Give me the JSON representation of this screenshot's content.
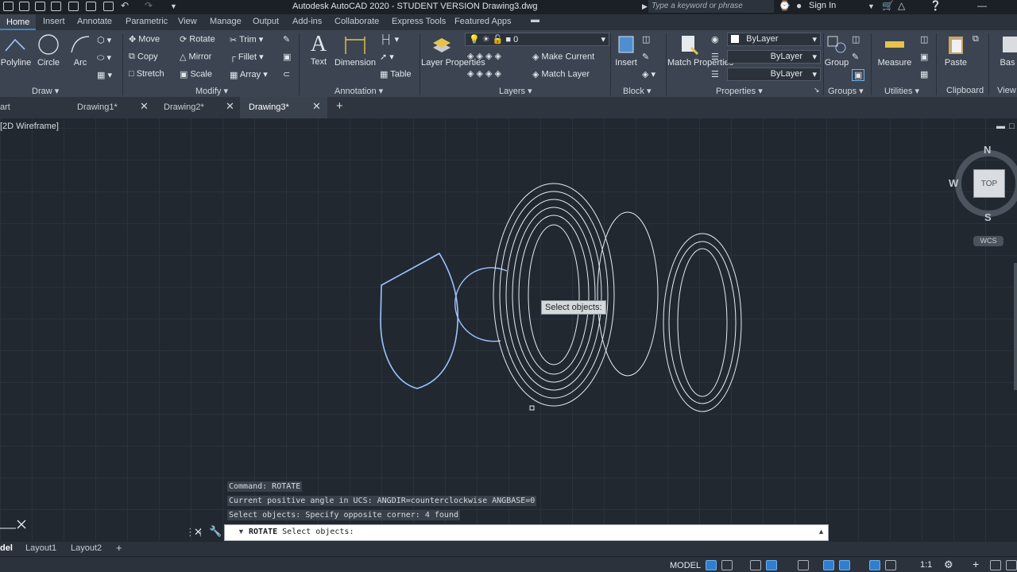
{
  "window": {
    "title": "Autodesk AutoCAD 2020 - STUDENT VERSION    Drawing3.dwg",
    "search_placeholder": "Type a keyword or phrase",
    "sign_in": "Sign In"
  },
  "ribbon_tabs": [
    "Home",
    "Insert",
    "Annotate",
    "Parametric",
    "View",
    "Manage",
    "Output",
    "Add-ins",
    "Collaborate",
    "Express Tools",
    "Featured Apps"
  ],
  "ribbon": {
    "draw": {
      "label": "Draw",
      "polyline": "Polyline",
      "circle": "Circle",
      "arc": "Arc"
    },
    "modify": {
      "label": "Modify",
      "move": "Move",
      "rotate": "Rotate",
      "trim": "Trim",
      "copy": "Copy",
      "mirror": "Mirror",
      "fillet": "Fillet",
      "stretch": "Stretch",
      "scale": "Scale",
      "array": "Array"
    },
    "annotation": {
      "label": "Annotation",
      "text": "Text",
      "dimension": "Dimension",
      "table": "Table"
    },
    "layers": {
      "label": "Layers",
      "layer_properties": "Layer Properties",
      "layer_value": "0",
      "make_current": "Make Current",
      "match_layer": "Match Layer"
    },
    "block": {
      "label": "Block",
      "insert": "Insert"
    },
    "properties": {
      "label": "Properties",
      "match_properties": "Match Properties",
      "color": "ByLayer",
      "linetype": "ByLayer",
      "lineweight": "ByLayer"
    },
    "groups": {
      "label": "Groups",
      "group": "Group"
    },
    "utilities": {
      "label": "Utilities",
      "measure": "Measure"
    },
    "clipboard": {
      "label": "Clipboard",
      "paste": "Paste"
    },
    "view": {
      "label": "View",
      "base": "Bas"
    }
  },
  "doc_tabs": [
    "art",
    "Drawing1*",
    "Drawing2*",
    "Drawing3*"
  ],
  "viewport_label": "[2D Wireframe]",
  "viewcube": {
    "n": "N",
    "w": "W",
    "s": "S",
    "top": "TOP",
    "wcs": "WCS"
  },
  "tooltip": "Select objects:",
  "command": {
    "history": [
      "Command: ROTATE",
      "Current positive angle in UCS:  ANGDIR=counterclockwise  ANGBASE=0",
      "Select objects: Specify opposite corner: 4 found"
    ],
    "current_cmd": "ROTATE",
    "prompt": "Select objects:"
  },
  "layout_tabs": [
    "del",
    "Layout1",
    "Layout2"
  ],
  "status": {
    "model": "MODEL",
    "scale": "1:1"
  },
  "colors": {
    "accent": "#3c86c7",
    "selected_stroke": "#9ec3ff",
    "drawing_stroke": "#e8ecf0"
  }
}
